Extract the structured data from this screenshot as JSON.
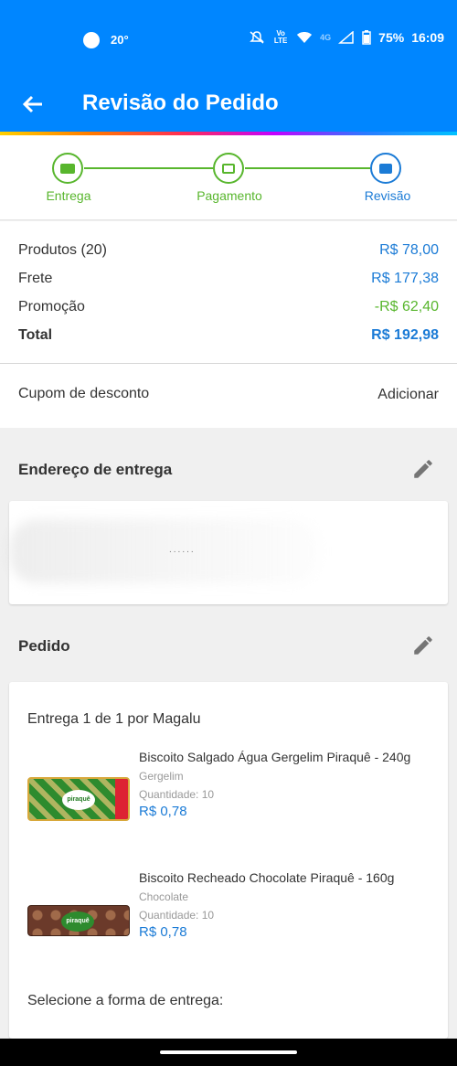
{
  "status_bar": {
    "temperature": "20°",
    "network_label": "Vo LTE",
    "network_gen": "4G",
    "battery": "75%",
    "time": "16:09"
  },
  "app_bar": {
    "title": "Revisão do Pedido"
  },
  "stepper": {
    "steps": [
      {
        "label": "Entrega",
        "state": "done"
      },
      {
        "label": "Pagamento",
        "state": "done"
      },
      {
        "label": "Revisão",
        "state": "active"
      }
    ]
  },
  "summary": {
    "rows": [
      {
        "label": "Produtos (20)",
        "value": "R$ 78,00"
      },
      {
        "label": "Frete",
        "value": "R$ 177,38"
      },
      {
        "label": "Promoção",
        "value": "-R$ 62,40"
      },
      {
        "label": "Total",
        "value": "R$ 192,98"
      }
    ]
  },
  "coupon": {
    "label": "Cupom de desconto",
    "action": "Adicionar"
  },
  "address": {
    "title": "Endereço de entrega",
    "placeholder_text": "......"
  },
  "order": {
    "title": "Pedido",
    "delivery_label": "Entrega 1 de 1 por Magalu",
    "products": [
      {
        "name": "Biscoito Salgado Água Gergelim Piraquê - 240g",
        "variant": "Gergelim",
        "quantity": "Quantidade:  10",
        "price": "R$ 0,78",
        "logo": "piraquê"
      },
      {
        "name": "Biscoito Recheado Chocolate Piraquê - 160g",
        "variant": "Chocolate",
        "quantity": "Quantidade:  10",
        "price": "R$ 0,78",
        "logo": "piraquê"
      }
    ],
    "select_delivery": "Selecione a forma de entrega:"
  },
  "colors": {
    "primary": "#0086ff",
    "accent_blue": "#1b7bd6",
    "success_green": "#58b62d"
  }
}
